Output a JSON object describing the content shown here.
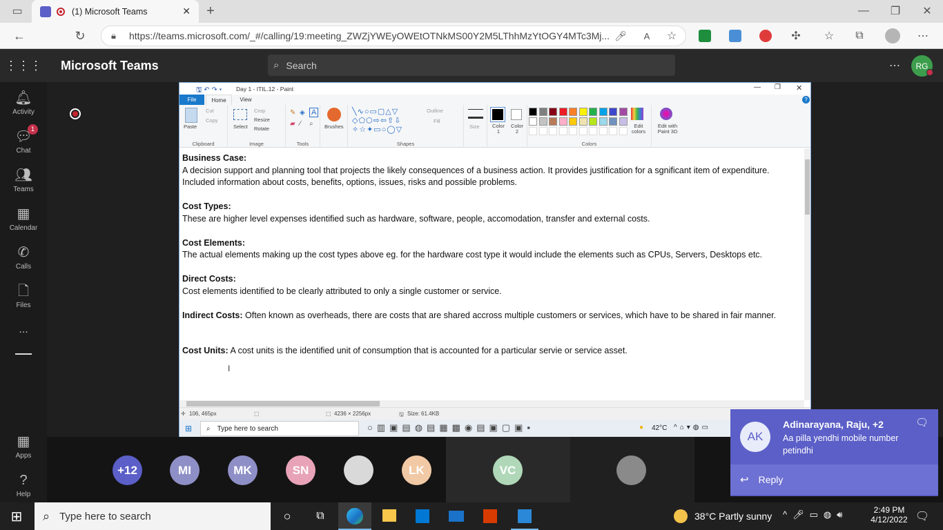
{
  "browser": {
    "tab_title": "(1) Microsoft Teams",
    "url": "https://teams.microsoft.com/_#/calling/19:meeting_ZWZjYWEyOWEtOTNkMS00Y2M5LThhMzYtOGY4MTc3Mj..."
  },
  "teams": {
    "app_title": "Microsoft Teams",
    "search_placeholder": "Search",
    "user_initials": "RG",
    "rail": [
      {
        "label": "Activity",
        "icon": "bell-icon"
      },
      {
        "label": "Chat",
        "icon": "chat-icon",
        "badge": "1"
      },
      {
        "label": "Teams",
        "icon": "teams-icon"
      },
      {
        "label": "Calendar",
        "icon": "calendar-icon"
      },
      {
        "label": "Calls",
        "icon": "phone-icon"
      },
      {
        "label": "Files",
        "icon": "file-icon"
      },
      {
        "label": "...",
        "icon": "more-icon"
      }
    ],
    "rail_bottom": [
      {
        "label": "Apps",
        "icon": "apps-icon"
      },
      {
        "label": "Help",
        "icon": "help-icon"
      }
    ]
  },
  "paint": {
    "title": "Day 1 - ITIL.12 - Paint",
    "menu": [
      "File",
      "Home",
      "View"
    ],
    "groups": [
      "Clipboard",
      "Image",
      "Tools",
      "Shapes",
      "Colors"
    ],
    "clipboard": {
      "paste": "Paste",
      "cut": "Cut",
      "copy": "Copy"
    },
    "image": {
      "select": "Select",
      "crop": "Crop",
      "resize": "Resize",
      "rotate": "Rotate"
    },
    "brushes": "Brushes",
    "outline": "Outline",
    "fill": "Fill",
    "size": "Size",
    "color1": "Color 1",
    "color2": "Color 2",
    "edit_colors": "Edit colors",
    "edit_3d": "Edit with Paint 3D",
    "palette": [
      "#000000",
      "#7f7f7f",
      "#880015",
      "#ed1c24",
      "#ff7f27",
      "#fff200",
      "#22b14c",
      "#00a2e8",
      "#3f48cc",
      "#a349a4",
      "#ffffff",
      "#c3c3c3",
      "#b97a57",
      "#ffaec9",
      "#ffc90e",
      "#efe4b0",
      "#b5e61d",
      "#99d9ea",
      "#7092be",
      "#c8bfe7"
    ],
    "content": [
      {
        "heading": "Business Case:",
        "inline": false,
        "text": "A decision support and planning tool that projects the likely consequences of a business action. It provides justification for a sgnificant item of expenditure. Included information about costs, benefits, options, issues, risks and possible problems."
      },
      {
        "heading": "Cost Types:",
        "inline": false,
        "text": "These are higher level expenses identified such as hardware, software, people, accomodation, transfer and external costs."
      },
      {
        "heading": "Cost Elements:",
        "inline": false,
        "text": "The actual elements making up the cost types above eg. for the hardware cost type it would include the elements such as CPUs, Servers, Desktops etc."
      },
      {
        "heading": "Direct Costs:",
        "inline": false,
        "text": "Cost elements identified to be clearly attributed to only a single customer or service."
      },
      {
        "heading": "Indirect Costs:",
        "inline": true,
        "text": "Often known as overheads, there are costs that are shared accross multiple customers or services, which have to be shared in fair manner."
      },
      {
        "heading": "Cost Units:",
        "inline": true,
        "text": "A cost units is the identified unit of consumption that is accounted for a particular servie or service asset."
      }
    ],
    "status": {
      "cursor": "106, 465px",
      "dimensions": "4236 × 2256px",
      "size": "Size: 61.4KB"
    },
    "inner_taskbar": {
      "search": "Type here to search",
      "weather": "42°C"
    }
  },
  "participants": [
    {
      "initials": "+12",
      "color": "#5b5fc7"
    },
    {
      "initials": "MI",
      "color": "#8f8fc7"
    },
    {
      "initials": "MK",
      "color": "#8f8fc7"
    },
    {
      "initials": "SN",
      "color": "#e8a3b8"
    },
    {
      "initials": "",
      "color": "#d9d9d9"
    },
    {
      "initials": "LK",
      "color": "#f2c9a5"
    },
    {
      "initials": "VC",
      "color": "#b0d8b8"
    },
    {
      "initials": "",
      "color": "#8a8a8a"
    }
  ],
  "toast": {
    "initials": "AK",
    "title": "Adinarayana, Raju, +2",
    "message": "Aa pilla yendhi mobile number petindhi",
    "reply": "Reply"
  },
  "taskbar": {
    "search": "Type here to search",
    "weather": "38°C  Partly sunny",
    "time": "2:49 PM",
    "date": "4/12/2022"
  }
}
